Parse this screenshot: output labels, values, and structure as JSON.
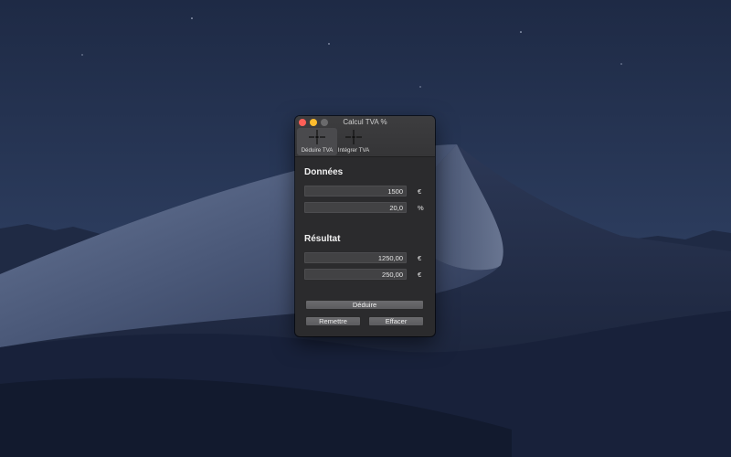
{
  "window": {
    "title": "Calcul TVA %"
  },
  "toolbar": {
    "items": [
      {
        "label": "Déduire TVA",
        "icon": "crosshair-icon",
        "active": true
      },
      {
        "label": "Intégrer TVA",
        "icon": "crosshair-icon",
        "active": false
      }
    ]
  },
  "donnees": {
    "title": "Données",
    "amount_value": "1500",
    "amount_unit": "€",
    "rate_value": "20,0",
    "rate_unit": "%"
  },
  "resultat": {
    "title": "Résultat",
    "net_value": "1250,00",
    "net_unit": "€",
    "tax_value": "250,00",
    "tax_unit": "€"
  },
  "buttons": {
    "deduire": "Déduire",
    "remettre": "Remettre",
    "effacer": "Effacer"
  },
  "colors": {
    "close": "#fe5f57",
    "minimize": "#febc2e",
    "maximize": "#6a6a6c",
    "window_bg": "#2b2b2d"
  }
}
